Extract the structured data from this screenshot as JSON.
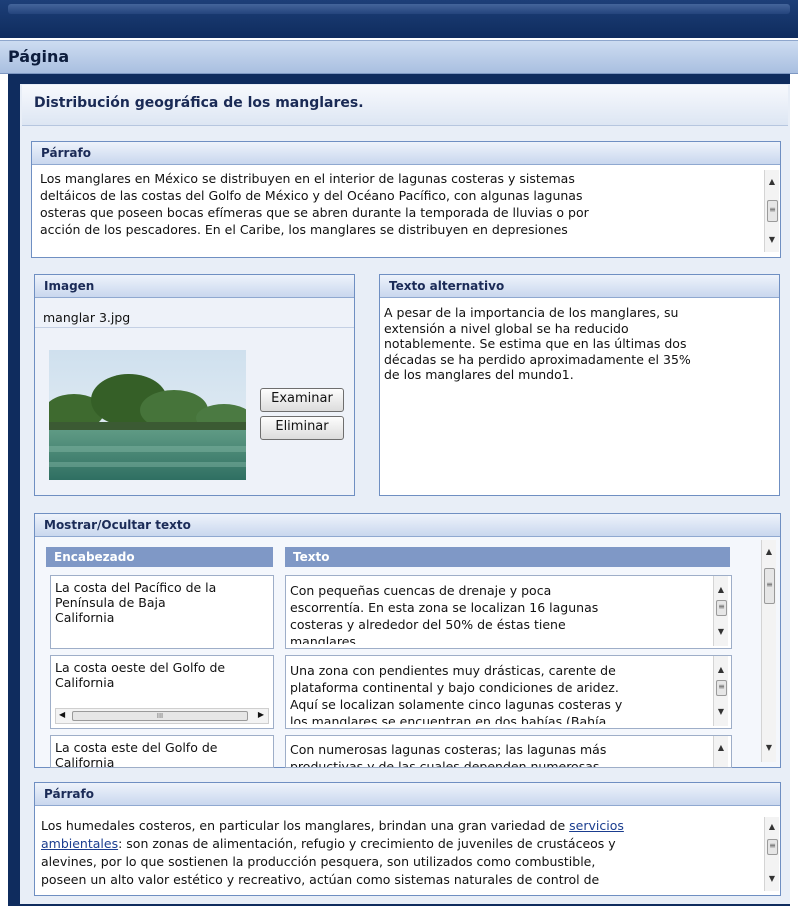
{
  "window": {
    "title": "Página"
  },
  "section": {
    "title": "Distribución geográfica de los manglares."
  },
  "parrafo1": {
    "header": "Párrafo",
    "lines": [
      "Los manglares en México se distribuyen en el interior de lagunas costeras y sistemas",
      "deltáicos de las costas del Golfo de México y del Océano Pacífico, con algunas lagunas",
      "osteras que poseen bocas efímeras que se abren durante la temporada de lluvias o por",
      "acción de los pescadores. En el Caribe, los manglares se distribuyen en depresiones"
    ]
  },
  "imagen": {
    "header": "Imagen",
    "filename": "manglar 3.jpg",
    "browse_label": "Examinar",
    "delete_label": "Eliminar"
  },
  "texto_alternativo": {
    "header": "Texto alternativo",
    "lines": [
      "A pesar de la importancia de los manglares, su",
      "extensión a nivel global se ha reducido",
      "notablemente. Se estima que en las últimas dos",
      "décadas se ha perdido aproximadamente el 35%",
      "de los manglares del mundo1."
    ]
  },
  "mostrar": {
    "header": "Mostrar/Ocultar texto",
    "col_encabezado": "Encabezado",
    "col_texto": "Texto",
    "rows": [
      {
        "heading": [
          "La costa del Pacífico de la",
          "Península de Baja",
          "California"
        ],
        "text": [
          "Con pequeñas cuencas de drenaje y poca",
          "escorrentía. En esta zona se localizan 16 lagunas",
          "costeras y alrededor del 50% de éstas tiene",
          "manglares"
        ]
      },
      {
        "heading": [
          "La costa oeste del Golfo de",
          "California"
        ],
        "text": [
          "Una zona con pendientes muy drásticas, carente de",
          "plataforma continental y bajo condiciones de aridez.",
          "Aquí se localizan solamente cinco lagunas costeras y",
          "los manglares se encuentran en dos bahías (Bahía"
        ]
      },
      {
        "heading": [
          "La costa este del Golfo de",
          "California"
        ],
        "text": [
          "Con numerosas lagunas costeras; las lagunas más",
          "productivas y de las cuales dependen numerosas"
        ]
      }
    ]
  },
  "parrafo2": {
    "header": "Párrafo",
    "line1_pre": "Los humedales costeros, en particular los manglares, brindan una gran variedad de ",
    "line1_link": "servicios",
    "line2_link": "ambientales",
    "line2_post": ": son zonas de alimentación, refugio y crecimiento de juveniles de crustáceos y",
    "line3": "alevines, por lo que sostienen la producción pesquera, son utilizados como combustible,",
    "line4": "poseen un alto valor estético y recreativo, actúan como sistemas naturales de control de"
  }
}
